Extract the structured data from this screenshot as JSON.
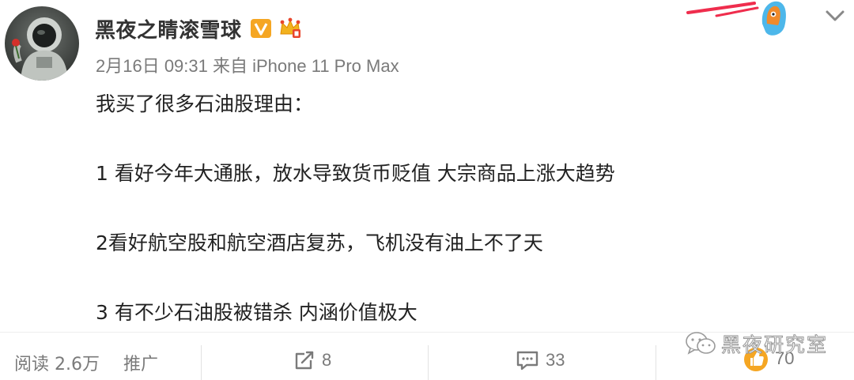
{
  "post": {
    "username": "黑夜之睛滚雪球",
    "timestamp": "2月16日 09:31",
    "source": "来自 iPhone 11 Pro Max",
    "lines": [
      "我买了很多石油股理由：",
      "",
      "1  看好今年大通胀，放水导致货币贬值 大宗商品上涨大趋势",
      "",
      "2看好航空股和航空酒店复苏，飞机没有油上不了天",
      "",
      "3 有不少石油股被错杀  内涵价值极大"
    ]
  },
  "footer": {
    "read_label": "阅读",
    "read_count": "2.6万",
    "promote_label": "推广",
    "repost_count": "8",
    "comment_count": "33",
    "like_count": "70"
  },
  "watermark": {
    "text": "黑夜研究室"
  },
  "colors": {
    "username": "#333333",
    "meta": "#7a7a7a",
    "body_text": "#222222",
    "verified_badge": "#f5a623",
    "vip_crown": "#f2b21e",
    "like_icon": "#f5a623"
  },
  "icons": {
    "verify": "verified-v-icon",
    "vip": "vip-crown-icon",
    "menu": "chevron-down-icon",
    "repost": "repost-icon",
    "comment": "comment-icon",
    "like": "like-thumb-icon",
    "watermark": "wechat-icon"
  }
}
